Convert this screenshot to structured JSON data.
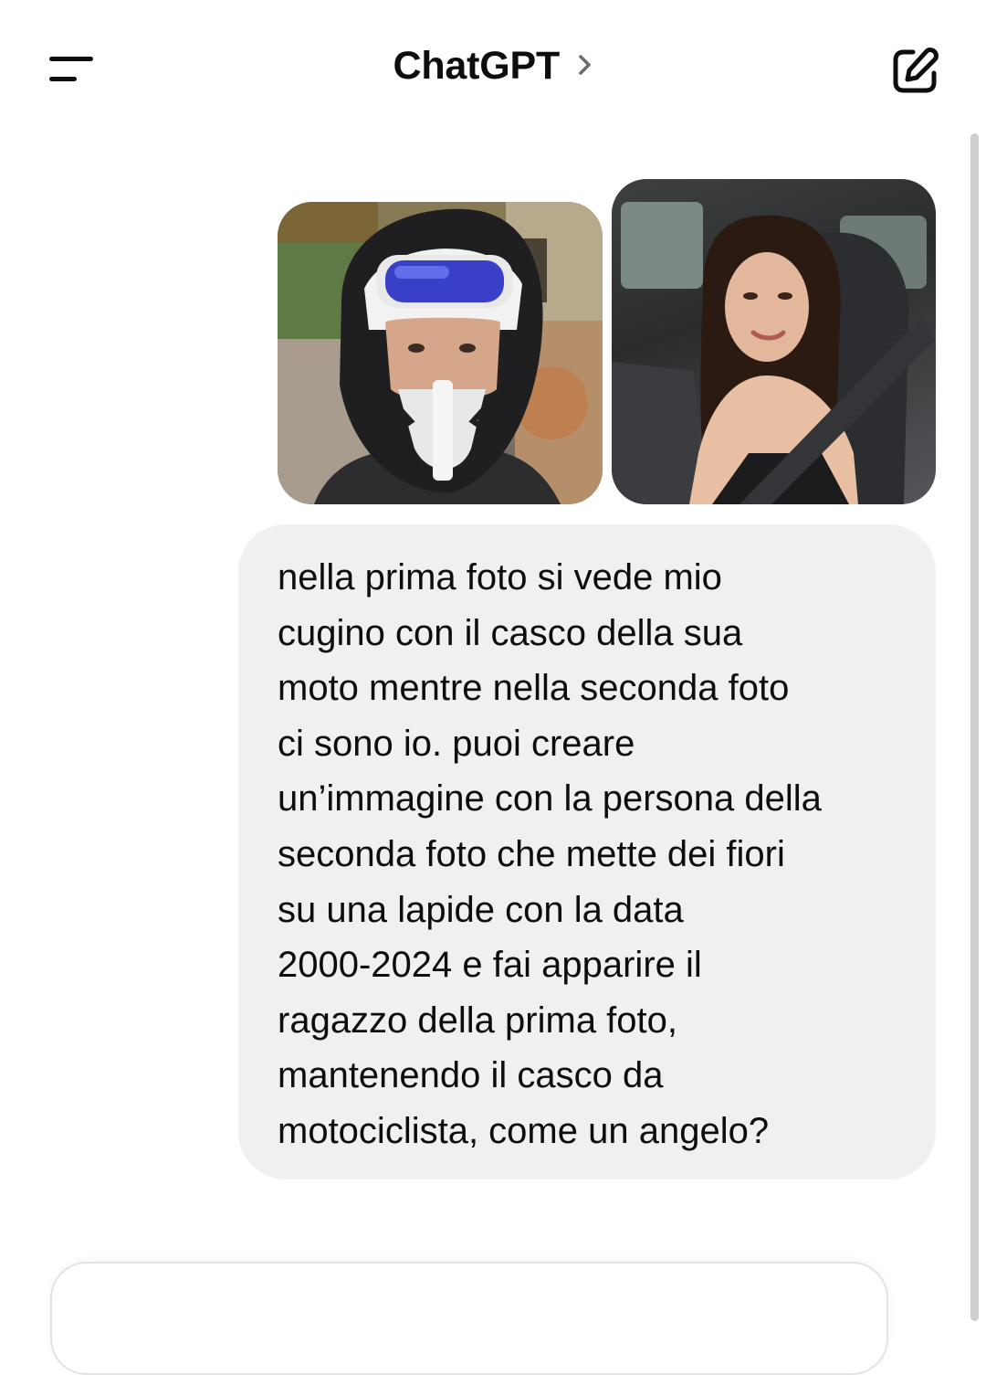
{
  "header": {
    "title": "ChatGPT",
    "menu_icon": "menu-icon",
    "title_chevron_icon": "chevron-right-icon",
    "edit_icon": "new-chat-edit-icon"
  },
  "conversation": {
    "attachments": [
      {
        "kind": "photo",
        "subject": "person wearing motocross helmet and goggles"
      },
      {
        "kind": "photo",
        "subject": "person seated in a car wearing a seatbelt"
      }
    ],
    "user_message": "nella prima foto si vede mio\ncugino con il casco della sua\nmoto mentre nella seconda foto\nci sono io. puoi creare\nun’immagine con la persona della\nseconda foto che mette dei fiori\nsu una lapide con la data\n2000-2024 e fai apparire il\nragazzo della prima foto,\nmantenendo il casco da\nmotociclista, come un angelo?"
  },
  "colors": {
    "text": "#0d0d0d",
    "bubble_bg": "#f0f0f0",
    "page_bg": "#ffffff",
    "scrollbar": "#cfcfcf"
  }
}
